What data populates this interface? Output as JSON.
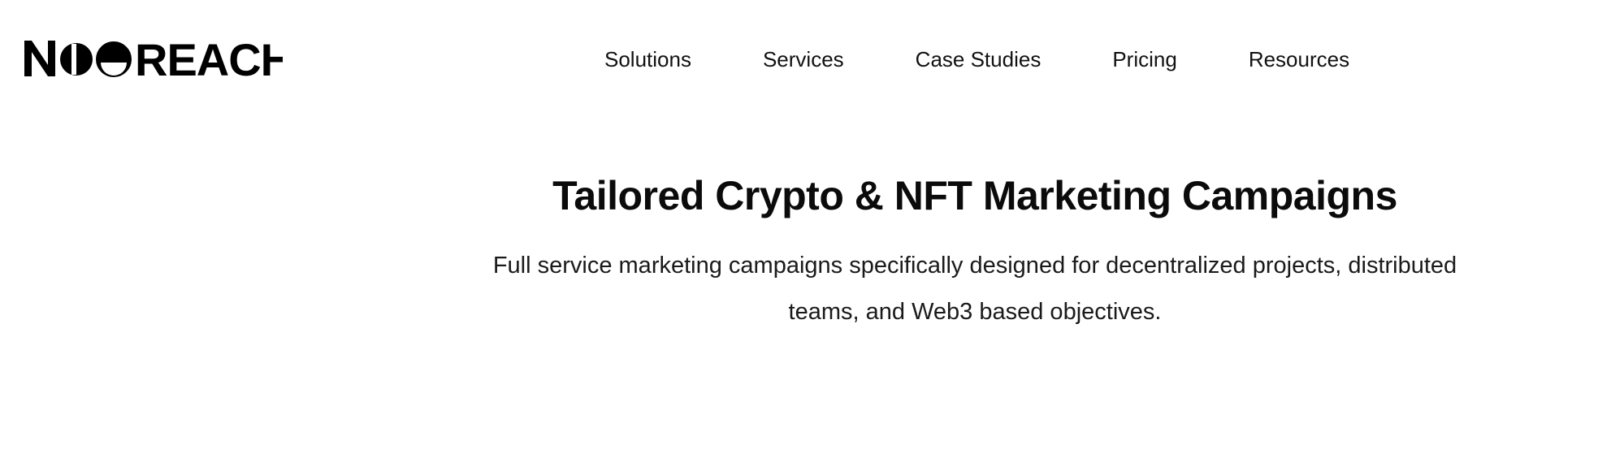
{
  "brand": {
    "name": "NEOREACH"
  },
  "nav": {
    "items": [
      {
        "label": "Solutions"
      },
      {
        "label": "Services"
      },
      {
        "label": "Case Studies"
      },
      {
        "label": "Pricing"
      },
      {
        "label": "Resources"
      }
    ]
  },
  "hero": {
    "title": "Tailored Crypto & NFT Marketing Campaigns",
    "subtitle": "Full service marketing campaigns specifically designed for decentralized projects, distributed teams, and Web3 based objectives."
  },
  "colors": {
    "background": "#ffffff",
    "text": "#000000"
  }
}
